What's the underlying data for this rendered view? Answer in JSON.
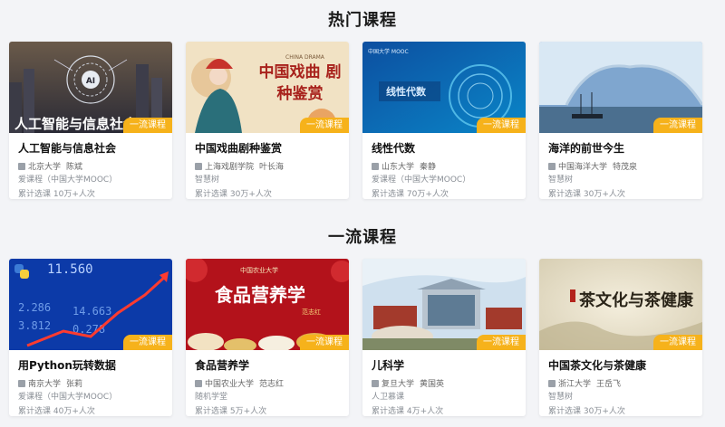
{
  "sections": [
    {
      "title": "热门课程",
      "courses": [
        {
          "title": "人工智能与信息社会",
          "school": "北京大学",
          "teacher": "陈斌",
          "platform": "爱课程（中国大学MOOC）",
          "count": "累计选课 10万+人次",
          "badge": "一流课程",
          "thumb_text": "人工智能与信息社会",
          "thumb_icon": "ai-brain-icon"
        },
        {
          "title": "中国戏曲剧种鉴赏",
          "school": "上海戏剧学院",
          "teacher": "叶长海",
          "platform": "智慧树",
          "count": "累计选课 30万+人次",
          "badge": "一流课程",
          "thumb_text": "中国戏曲 剧种鉴赏",
          "thumb_sub": "CHINA DRAMA",
          "thumb_icon": "opera-figure-icon"
        },
        {
          "title": "线性代数",
          "school": "山东大学",
          "teacher": "秦静",
          "platform": "爱课程（中国大学MOOC）",
          "count": "累计选课 70万+人次",
          "badge": "一流课程",
          "thumb_text": "线性代数",
          "thumb_sub": "中国大学 MOOC",
          "thumb_icon": "wave-rings-icon"
        },
        {
          "title": "海洋的前世今生",
          "school": "中国海洋大学",
          "teacher": "特茂泉",
          "platform": "智慧树",
          "count": "累计选课 30万+人次",
          "badge": "一流课程",
          "thumb_icon": "ship-iceberg-icon"
        }
      ]
    },
    {
      "title": "一流课程",
      "courses": [
        {
          "title": "用Python玩转数据",
          "school": "南京大学",
          "teacher": "张莉",
          "platform": "爱课程（中国大学MOOC）",
          "count": "累计选课 40万+人次",
          "badge": "一流课程",
          "thumb_text": "11.560",
          "thumb_icon": "python-logo-icon"
        },
        {
          "title": "食品营养学",
          "school": "中国农业大学",
          "teacher": "范志红",
          "platform": "随机学堂",
          "count": "累计选课 5万+人次",
          "badge": "一流课程",
          "thumb_text": "食品营养学",
          "thumb_sub": "中国农业大学",
          "thumb_author": "范志红",
          "thumb_icon": "dishes-icon"
        },
        {
          "title": "儿科学",
          "school": "复旦大学",
          "teacher": "黄国英",
          "platform": "人卫慕课",
          "count": "累计选课 4万+人次",
          "badge": "一流课程",
          "thumb_icon": "campus-building-icon"
        },
        {
          "title": "中国茶文化与茶健康",
          "school": "浙江大学",
          "teacher": "王岳飞",
          "platform": "智慧树",
          "count": "累计选课 30万+人次",
          "badge": "一流课程",
          "thumb_text": "茶文化与茶健康",
          "thumb_icon": "tea-ink-icon"
        }
      ]
    }
  ],
  "colors": {
    "badge": "#f6b21b",
    "background": "#f3f4f7"
  }
}
